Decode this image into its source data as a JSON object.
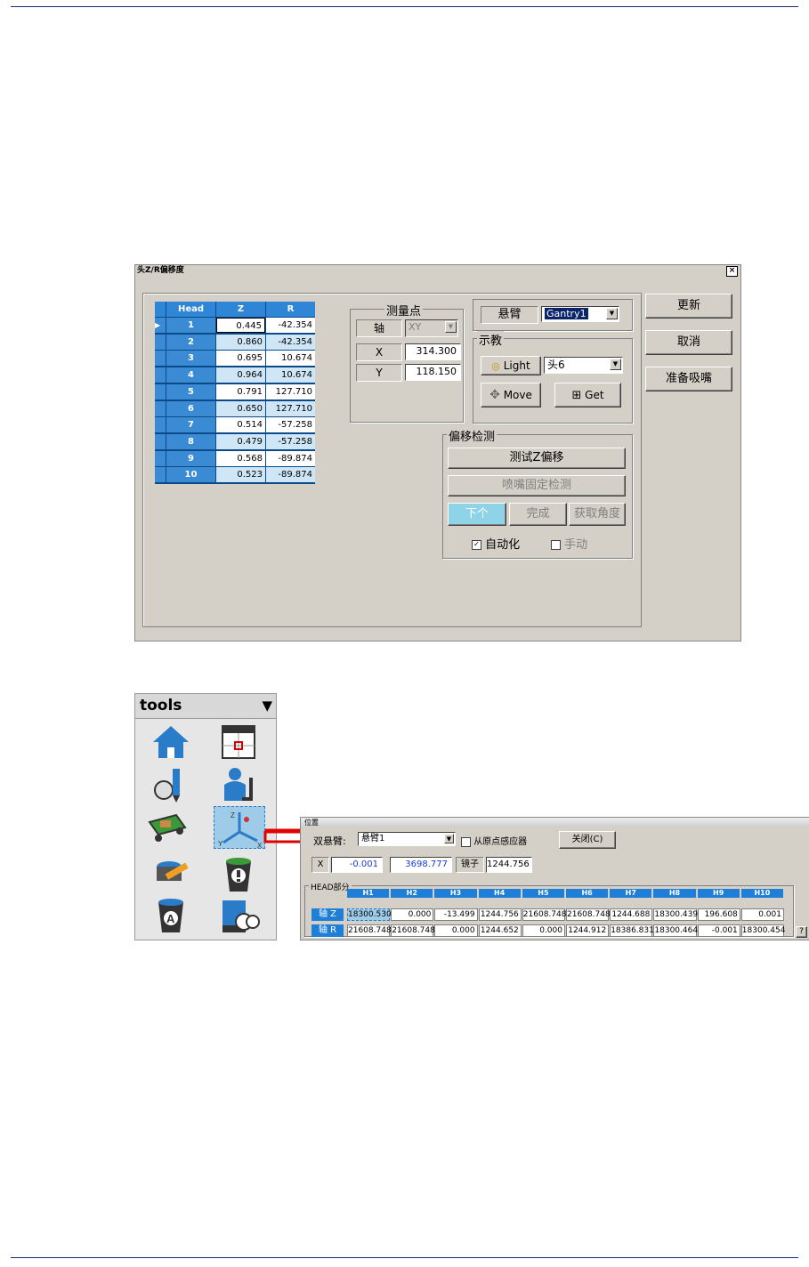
{
  "dialog": {
    "title": "头Z/R偏移度",
    "close_glyph": "×",
    "head_table": {
      "columns": [
        "Head",
        "Z",
        "R"
      ],
      "rows": [
        {
          "head": "1",
          "z": "0.445",
          "r": "-42.354"
        },
        {
          "head": "2",
          "z": "0.860",
          "r": "-42.354"
        },
        {
          "head": "3",
          "z": "0.695",
          "r": "10.674"
        },
        {
          "head": "4",
          "z": "0.964",
          "r": "10.674"
        },
        {
          "head": "5",
          "z": "0.791",
          "r": "127.710"
        },
        {
          "head": "6",
          "z": "0.650",
          "r": "127.710"
        },
        {
          "head": "7",
          "z": "0.514",
          "r": "-57.258"
        },
        {
          "head": "8",
          "z": "0.479",
          "r": "-57.258"
        },
        {
          "head": "9",
          "z": "0.568",
          "r": "-89.874"
        },
        {
          "head": "10",
          "z": "0.523",
          "r": "-89.874"
        }
      ]
    },
    "measure_point": {
      "legend": "测量点",
      "axis_label": "轴",
      "axis_value": "XY",
      "x_label": "X",
      "x_value": "314.300",
      "y_label": "Y",
      "y_value": "118.150"
    },
    "gantry": {
      "label": "悬臂",
      "value": "Gantry1"
    },
    "teach": {
      "legend": "示教",
      "light_label": "Light",
      "head_value": "头6",
      "move_label": "Move",
      "get_label": "Get"
    },
    "offset_detect": {
      "legend": "偏移检测",
      "test_z_label": "测试Z偏移",
      "nozzle_check_label": "喷嘴固定检测",
      "next_label": "下个",
      "done_label": "完成",
      "get_angle_label": "获取角度",
      "auto_label": "自动化",
      "auto_checked": true,
      "manual_label": "手动",
      "manual_checked": false
    },
    "buttons": {
      "update": "更新",
      "cancel": "取消",
      "prepare": "准备吸嘴"
    }
  },
  "tools": {
    "title": "tools",
    "dropdown_glyph": "▼"
  },
  "position_window": {
    "title": "位置",
    "dual_gantry_label": "双悬臂:",
    "gantry_value": "悬臂1",
    "home_sensor_label": "从原点感应器",
    "close_label": "关闭(C)",
    "x_label": "X",
    "x_value": "-0.001",
    "y_value": "3698.777",
    "mirror_label": "镜子",
    "mirror_value": "1244.756",
    "head_section_label": "HEAD部分",
    "head_columns": [
      "H1",
      "H2",
      "H3",
      "H4",
      "H5",
      "H6",
      "H7",
      "H8",
      "H9",
      "H10"
    ],
    "axis_z_label": "轴 Z",
    "axis_z_values": [
      "18300.530",
      "0.000",
      "-13.499",
      "1244.756",
      "21608.748",
      "21608.748",
      "1244.688",
      "18300.439",
      "196.608",
      "0.001"
    ],
    "axis_r_label": "轴 R",
    "axis_r_values": [
      "21608.748",
      "21608.748",
      "0.000",
      "1244.652",
      "0.000",
      "1244.912",
      "18386.831",
      "18300.464",
      "-0.001",
      "18300.454"
    ],
    "help_glyph": "?"
  }
}
